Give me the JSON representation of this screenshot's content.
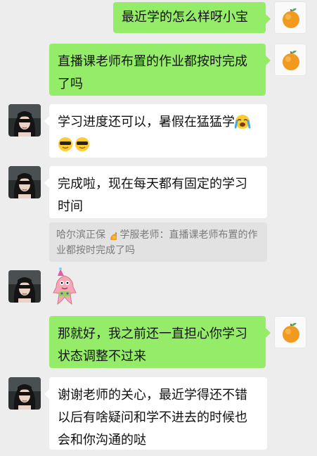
{
  "messages": [
    {
      "text": "最近学的怎么样呀小宝"
    },
    {
      "text": "直播课老师布置的作业都按时完成了吗"
    },
    {
      "text": "学习进度还可以，暑假在猛猛学",
      "emojis": [
        "loudly-crying-face",
        "smiling-face-with-sunglasses",
        "smiling-face-with-sunglasses"
      ]
    },
    {
      "text": "完成啦，现在每天都有固定的学习时间"
    },
    {
      "quote": "哈尔滨正保",
      "quote_rest": " 学服老师：直播课老师布置的作业都按时完成了吗"
    },
    {
      "sticker": "patrick-star-sticker"
    },
    {
      "text": "那就好，我之前还一直担心你学习状态调整不过来"
    },
    {
      "text": "谢谢老师的关心，最近学得还不错以后有啥疑问和学不进去的时候也会和你沟通的哒"
    }
  ],
  "colors": {
    "background": "#ededed",
    "sent_bubble": "#95ec69",
    "received_bubble": "#ffffff",
    "quote_bg": "#e2e2e2"
  }
}
